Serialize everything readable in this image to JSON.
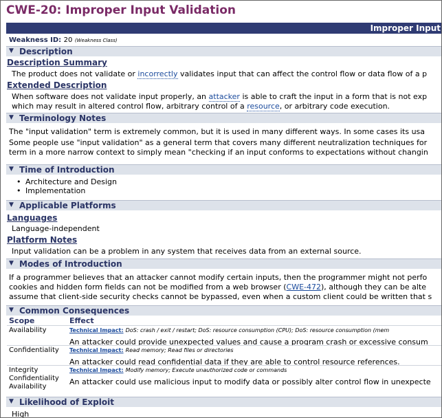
{
  "title": "CWE-20: Improper Input Validation",
  "banner": "Improper Input",
  "weakness": {
    "label": "Weakness ID:",
    "id": "20",
    "class": "(Weakness Class)"
  },
  "description": {
    "section": "Description",
    "summary_heading": "Description Summary",
    "summary": [
      "The product does not validate or ",
      "incorrectly",
      " validates input that can affect the control flow or data flow of a p"
    ],
    "extended_heading": "Extended Description",
    "extended_1": [
      "When software does not validate input properly, an ",
      "attacker",
      " is able to craft the input in a form that is not exp"
    ],
    "extended_2": [
      "which may result in altered control flow, arbitrary control of a ",
      "resource",
      ", or arbitrary code execution."
    ]
  },
  "terminology": {
    "section": "Terminology Notes",
    "line1": "The \"input validation\" term is extremely common, but it is used in many different ways. In some cases its usa",
    "line2": "Some people use \"input validation\" as a general term that covers many different neutralization techniques for",
    "line3": "term in a more narrow context to simply mean \"checking if an input conforms to expectations without changin"
  },
  "time_of_introduction": {
    "section": "Time of Introduction",
    "items": [
      "Architecture and Design",
      "Implementation"
    ]
  },
  "platforms": {
    "section": "Applicable Platforms",
    "languages_heading": "Languages",
    "language": "Language-independent",
    "notes_heading": "Platform Notes",
    "notes": "Input validation can be a problem in any system that receives data from an external source."
  },
  "modes": {
    "section": "Modes of Introduction",
    "line1": "If a programmer believes that an attacker cannot modify certain inputs, then the programmer might not perfo",
    "line2a": "cookies and hidden form fields can not be modified from a web browser (",
    "line2link": "CWE-472",
    "line2b": "), although they can be alte",
    "line3": "assume that client-side security checks cannot be bypassed, even when a custom client could be written that s"
  },
  "consequences": {
    "section": "Common Consequences",
    "col_scope": "Scope",
    "col_effect": "Effect",
    "ti_label": "Technical Impact:",
    "rows": [
      {
        "scope": "Availability",
        "impact": "DoS: crash / exit / restart; DoS: resource consumption (CPU); DoS: resource consumption (mem",
        "desc": "An attacker could provide unexpected values and cause a program crash or excessive consum"
      },
      {
        "scope": "Confidentiality",
        "impact": "Read memory; Read files or directories",
        "desc": "An attacker could read confidential data if they are able to control resource references."
      },
      {
        "scope1": "Integrity",
        "scope2": "Confidentiality",
        "scope3": "Availability",
        "impact": "Modify memory; Execute unauthorized code or commands",
        "desc": "An attacker could use malicious input to modify data or possibly alter control flow in unexpecte"
      }
    ]
  },
  "likelihood": {
    "section": "Likelihood of Exploit",
    "value": "High"
  }
}
